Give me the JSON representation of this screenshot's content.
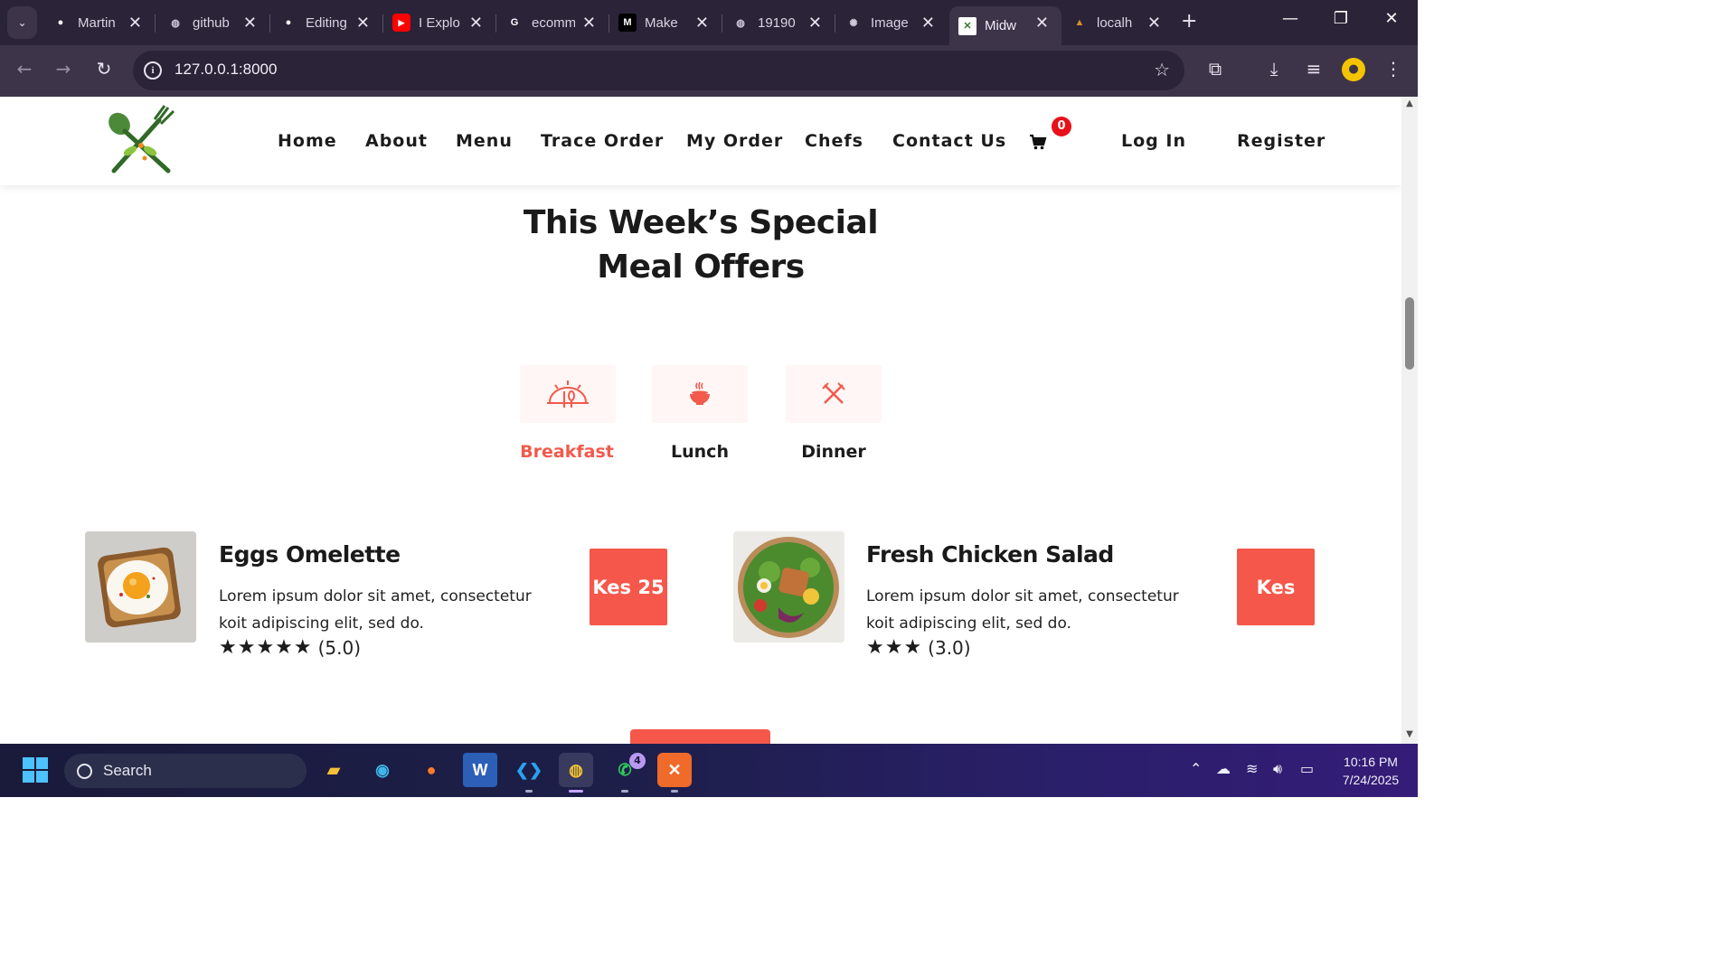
{
  "browser": {
    "tabs": [
      {
        "title": "Martin",
        "favicon": "github-icon",
        "color": "#ffffff"
      },
      {
        "title": "github",
        "favicon": "globe-icon",
        "color": "#cfc8d8"
      },
      {
        "title": "Editing",
        "favicon": "github-icon",
        "color": "#ffffff"
      },
      {
        "title": "I Explo",
        "favicon": "youtube-icon",
        "color": "#ff0000"
      },
      {
        "title": "ecomm",
        "favicon": "google-icon",
        "color": "#ffffff"
      },
      {
        "title": "Make",
        "favicon": "medium-icon",
        "color": "#000000"
      },
      {
        "title": "19190",
        "favicon": "globe-icon",
        "color": "#cfc8d8"
      },
      {
        "title": "Image",
        "favicon": "openai-icon",
        "color": "#cfc8d8"
      },
      {
        "title": "Midw",
        "favicon": "site-favicon-icon",
        "color": "#ffffff"
      },
      {
        "title": "localh",
        "favicon": "localhost-icon",
        "color": "#d8902a"
      }
    ],
    "active_tab_index": 8,
    "url": "127.0.0.1:8000"
  },
  "site": {
    "nav": {
      "home": "Home",
      "about": "About",
      "menu": "Menu",
      "trace_order": "Trace Order",
      "my_order": "My Order",
      "chefs": "Chefs",
      "contact": "Contact Us",
      "cart_count": "0",
      "login": "Log In",
      "register": "Register"
    },
    "section_title_line1": "This Week’s Special",
    "section_title_line2": "Meal Offers",
    "meal_tabs": {
      "breakfast": "Breakfast",
      "lunch": "Lunch",
      "dinner": "Dinner",
      "active": "Breakfast"
    },
    "items": [
      {
        "name": "Eggs Omelette",
        "description": "Lorem ipsum dolor sit amet, consectetur koit adipiscing elit, sed do.",
        "rating_text": "(5.0)",
        "stars": 5,
        "price": "Kes 25"
      },
      {
        "name": "Fresh Chicken Salad",
        "description": "Lorem ipsum dolor sit amet, consectetur koit adipiscing elit, sed do.",
        "rating_text": "(3.0)",
        "stars": 3,
        "price": "Kes"
      }
    ],
    "accent_color": "#f5574a"
  },
  "taskbar": {
    "search_placeholder": "Search",
    "whatsapp_badge": "4",
    "time": "10:16 PM",
    "date": "7/24/2025"
  }
}
